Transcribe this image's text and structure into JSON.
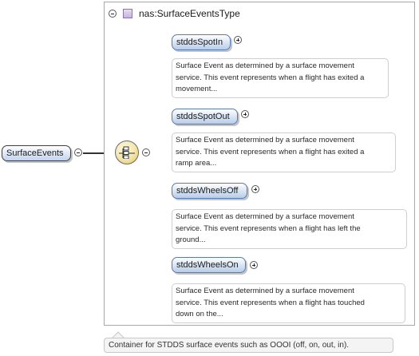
{
  "type_container": {
    "title": "nas:SurfaceEventsType"
  },
  "root": {
    "label": "SurfaceEvents"
  },
  "compositor": {
    "kind": "sequence"
  },
  "elements": [
    {
      "label": "stddsSpotIn",
      "doc_lines": [
        "Surface Event as determined by a surface movement",
        "service. This event represents when a flight has exited a",
        "movement..."
      ]
    },
    {
      "label": "stddsSpotOut",
      "doc_lines": [
        "Surface Event as determined by a surface movement",
        "service. This event represents when a flight has exited a",
        "ramp area..."
      ]
    },
    {
      "label": "stddsWheelsOff",
      "doc_lines": [
        "Surface Event as determined by a surface movement",
        "service. This event represents when a flight has left the",
        "ground..."
      ]
    },
    {
      "label": "stddsWheelsOn",
      "doc_lines": [
        "Surface Event as determined by a surface movement",
        "service. This event represents when a flight has touched",
        "down on the..."
      ]
    }
  ],
  "root_annotation": "Container for STDDS surface events such as OOOI (off, on, out, in).",
  "colors": {
    "element_border": "#5b7ba8",
    "element_fill_bottom": "#b8cdea",
    "compositor_fill": "#f3e4a6",
    "type_icon": "#c7b4df"
  },
  "icons": [
    "collapse-icon",
    "expand-icon",
    "complex-type-icon",
    "sequence-icon"
  ]
}
